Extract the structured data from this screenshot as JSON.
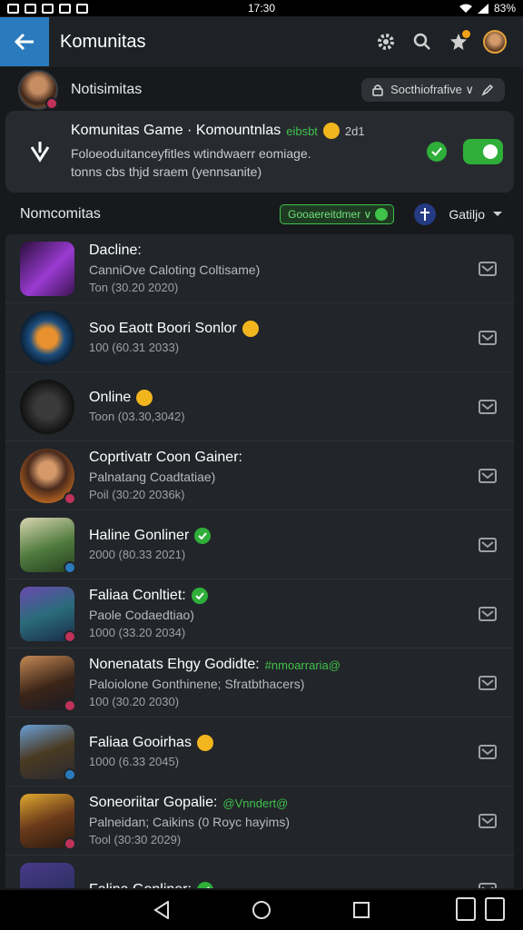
{
  "status_bar": {
    "time": "17:30",
    "battery": "83%"
  },
  "app_bar": {
    "title": "Komunitas"
  },
  "notif": {
    "title": "Notisimitas",
    "button_label": "Socthiofrafive ∨"
  },
  "community": {
    "title": "Komunitas Game · Komountnlas",
    "tag": "eibsbt",
    "count": "2d1",
    "subtitle_1": "Foloeoduitanceyfitles wtindwaerr eomiage.",
    "subtitle_2": "tonns cbs thjd sraem (yennsanite)"
  },
  "section": {
    "title": "Nomcomitas",
    "chip_label": "Gooaereitdmer ∨",
    "sort_label": "Gatiljo"
  },
  "items": [
    {
      "title": "Dacline:",
      "sub": "CanniOve Caloting Coltisame)",
      "date": "Ton (30.20 2020)",
      "thumb": "linear-gradient(135deg,#2a0f3c,#9a3ad1 55%,#3a1452)",
      "round": false,
      "emoji": false,
      "check": false,
      "tag": ""
    },
    {
      "title": "Soo Eaott Boori Sonlor",
      "sub": "",
      "date": "100 (60.31 2033)",
      "thumb": "radial-gradient(circle,#e8912e 25%,#1c4e7e 45%,#0b2036 70%)",
      "round": true,
      "emoji": true,
      "check": false,
      "tag": ""
    },
    {
      "title": "Online",
      "sub": "",
      "date": "Toon (03.30,3042)",
      "thumb": "radial-gradient(circle,#3a3a3a 30%,#111 70%)",
      "round": true,
      "emoji": true,
      "check": false,
      "tag": ""
    },
    {
      "title": "Coprtivatr Coon Gainer:",
      "sub": "Palnatang Coadtatiae)",
      "date": "Poil (30:20 2036k)",
      "thumb": "radial-gradient(circle at 50% 40%,#d69a6a 20%,#4a2a1c 45%,#e07a22 90%)",
      "round": true,
      "emoji": false,
      "check": false,
      "tag": ""
    },
    {
      "title": "Haline Gonliner",
      "sub": "",
      "date": "2000 (80.33 2021)",
      "thumb": "linear-gradient(160deg,#d9d6b0,#4f7a3e 55%,#274020)",
      "round": false,
      "emoji": false,
      "check": true,
      "tag": ""
    },
    {
      "title": "Faliaa Conltiet:",
      "sub": "Paole Codaedtiao)",
      "date": "1000 (33.20 2034)",
      "thumb": "linear-gradient(160deg,#6a4ab0,#2a6b7a 50%,#1a2c4a)",
      "round": false,
      "emoji": false,
      "check": true,
      "tag": ""
    },
    {
      "title": "Nonenatats Ehgy Godidte:",
      "sub": "Paloiolone Gonthinene; Sfratbthacers)",
      "date": "100 (30.20 2030)",
      "thumb": "linear-gradient(160deg,#c58a55,#3a2418 55%,#1a1c24)",
      "round": false,
      "emoji": false,
      "check": false,
      "tag": "#nmoarraria@"
    },
    {
      "title": "Faliaa Gooirhas",
      "sub": "",
      "date": "1000 (6.33 2045)",
      "thumb": "linear-gradient(160deg,#6aa0d8,#4a3a22 50%,#2a2a30)",
      "round": false,
      "emoji": true,
      "check": false,
      "tag": ""
    },
    {
      "title": "Soneoriitar Gopalie:",
      "sub": "Palneidan; Caikins (0 Royc hayims)",
      "date": "Tool (30:30 2029)",
      "thumb": "linear-gradient(160deg,#e0a830,#6a3a1a 50%,#2a1a10)",
      "round": false,
      "emoji": false,
      "check": false,
      "tag": "@Vnndert@"
    },
    {
      "title": "Falina Gonliner:",
      "sub": "",
      "date": "",
      "thumb": "linear-gradient(160deg,#4a3a8a,#1c2a4a)",
      "round": false,
      "emoji": false,
      "check": true,
      "tag": ""
    }
  ],
  "icons": {
    "back": "back-arrow-icon",
    "settings": "gear-icon",
    "search": "search-icon",
    "notif": "star-bell-icon",
    "nav_back": "triangle-back-icon",
    "nav_home": "circle-home-icon",
    "nav_recent": "square-recent-icon"
  },
  "colors": {
    "accent_blue": "#2a7bbd",
    "accent_green": "#2fae3a",
    "surface": "#222529",
    "background": "#17191c"
  }
}
